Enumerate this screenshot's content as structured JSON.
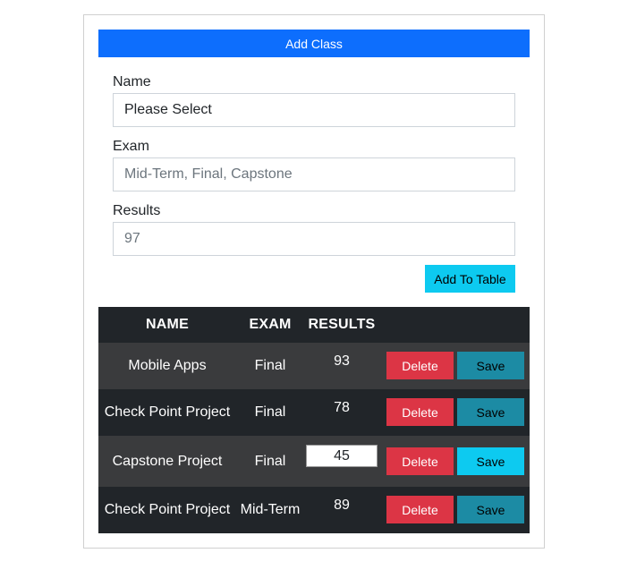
{
  "header": {
    "title": "Add Class"
  },
  "form": {
    "name": {
      "label": "Name",
      "value": "Please Select"
    },
    "exam": {
      "label": "Exam",
      "placeholder": "Mid-Term, Final, Capstone"
    },
    "results": {
      "label": "Results",
      "placeholder": "97"
    },
    "submit_label": "Add To Table"
  },
  "table": {
    "headers": [
      "NAME",
      "EXAM",
      "RESULTS"
    ],
    "rows": [
      {
        "name": "Mobile Apps",
        "exam": "Final",
        "result": "93",
        "delete": "Delete",
        "save": "Save"
      },
      {
        "name": "Check Point Project",
        "exam": "Final",
        "result": "78",
        "delete": "Delete",
        "save": "Save"
      },
      {
        "name": "Capstone Project",
        "exam": "Final",
        "result": "45",
        "delete": "Delete",
        "save": "Save",
        "editing": true
      },
      {
        "name": "Check Point Project",
        "exam": "Mid-Term",
        "result": "89",
        "delete": "Delete",
        "save": "Save"
      }
    ]
  },
  "colors": {
    "primary": "#0d6efd",
    "info": "#0dcaf0",
    "danger": "#dc3545",
    "table_dark": "#212529",
    "table_striped": "#3a3b3d"
  }
}
